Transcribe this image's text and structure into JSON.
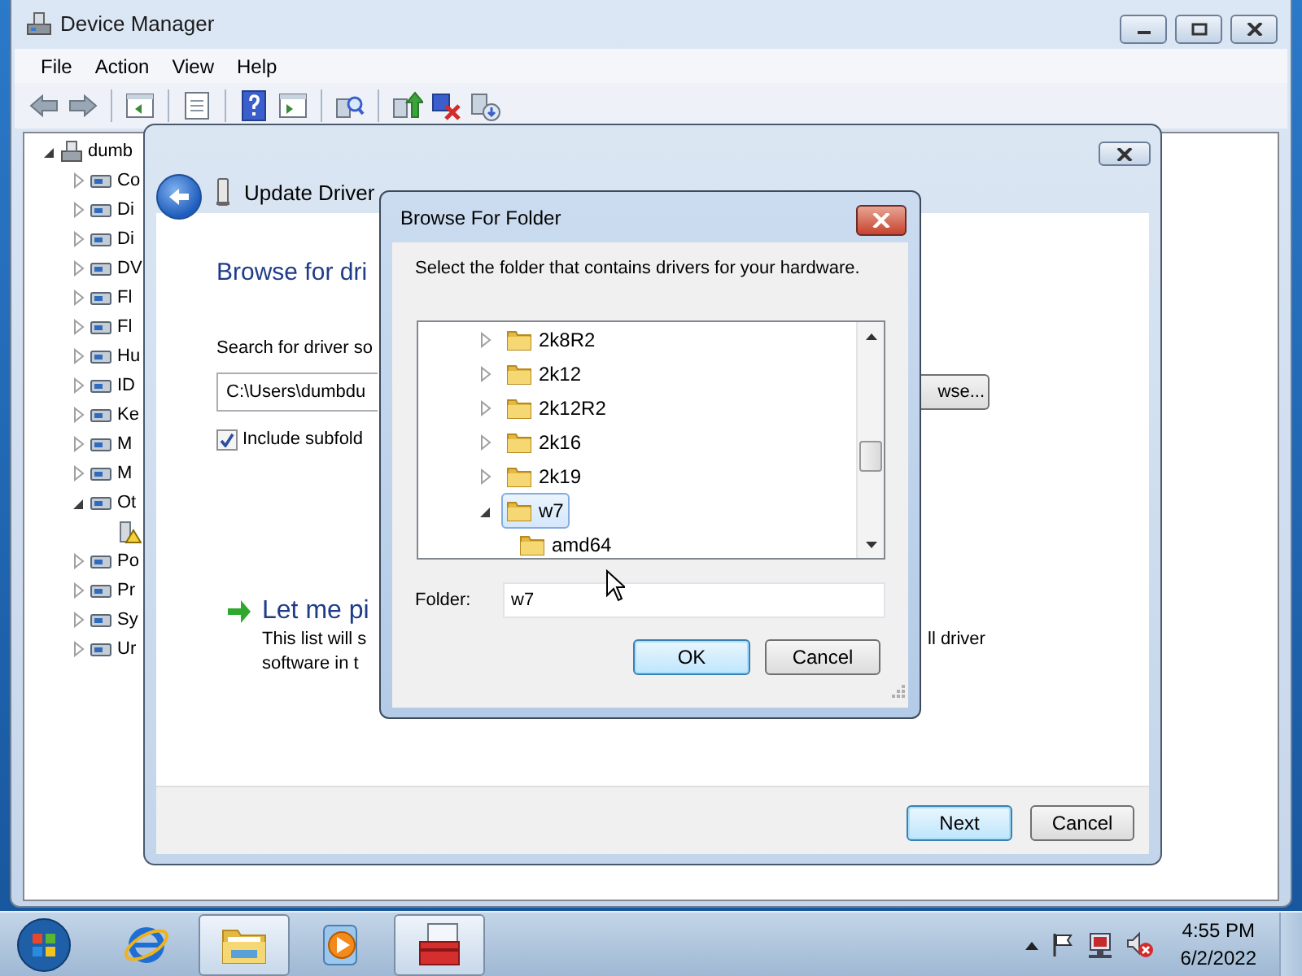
{
  "device_manager": {
    "title": "Device Manager",
    "menu": [
      "File",
      "Action",
      "View",
      "Help"
    ],
    "tree": [
      {
        "label": "dumb",
        "kind": "computer",
        "expanded": true,
        "children": [
          {
            "label": "Co",
            "kind": "device",
            "expanded": false
          },
          {
            "label": "Di",
            "kind": "device",
            "expanded": false
          },
          {
            "label": "Di",
            "kind": "device",
            "expanded": false
          },
          {
            "label": "DV",
            "kind": "device",
            "expanded": false
          },
          {
            "label": "Fl",
            "kind": "device",
            "expanded": false
          },
          {
            "label": "Fl",
            "kind": "device",
            "expanded": false
          },
          {
            "label": "Hu",
            "kind": "device",
            "expanded": false
          },
          {
            "label": "ID",
            "kind": "device",
            "expanded": false
          },
          {
            "label": "Ke",
            "kind": "device",
            "expanded": false
          },
          {
            "label": "M",
            "kind": "device",
            "expanded": false
          },
          {
            "label": "M",
            "kind": "device",
            "expanded": false
          },
          {
            "label": "Ot",
            "kind": "device",
            "expanded": true,
            "children": [
              {
                "kind": "warning"
              }
            ]
          },
          {
            "label": "Po",
            "kind": "device",
            "expanded": false
          },
          {
            "label": "Pr",
            "kind": "device",
            "expanded": false
          },
          {
            "label": "Sy",
            "kind": "device",
            "expanded": false
          },
          {
            "label": "Ur",
            "kind": "device",
            "expanded": false
          }
        ]
      }
    ]
  },
  "wizard": {
    "title": "Update Driver",
    "heading": "Browse for dri",
    "search_label": "Search for driver so",
    "path": "C:\\Users\\dumbdu",
    "browse_button": "wse...",
    "include_subfolders": {
      "label": "Include subfold",
      "checked": true
    },
    "pick_title": "Let me pi",
    "pick_line_1": "This list will s",
    "pick_line_1_end": "ll driver",
    "pick_line_2": "software in t",
    "buttons": [
      {
        "label": "Next",
        "default": true
      },
      {
        "label": "Cancel",
        "default": false
      }
    ]
  },
  "browse_dialog": {
    "title": "Browse For Folder",
    "prompt": "Select the folder that contains drivers for your hardware.",
    "folders": [
      {
        "label": "2k8R2",
        "expanded": false,
        "selected": false
      },
      {
        "label": "2k12",
        "expanded": false,
        "selected": false
      },
      {
        "label": "2k12R2",
        "expanded": false,
        "selected": false
      },
      {
        "label": "2k16",
        "expanded": false,
        "selected": false
      },
      {
        "label": "2k19",
        "expanded": false,
        "selected": false
      },
      {
        "label": "w7",
        "expanded": true,
        "selected": true,
        "children": [
          {
            "label": "amd64",
            "selected": false
          }
        ]
      }
    ],
    "folder_label": "Folder:",
    "folder_value": "w7",
    "buttons": [
      {
        "label": "OK",
        "default": true
      },
      {
        "label": "Cancel",
        "default": false
      }
    ]
  },
  "taskbar": {
    "apps": [
      {
        "kind": "browser",
        "active": false
      },
      {
        "kind": "explorer",
        "active": true
      },
      {
        "kind": "media",
        "active": false
      },
      {
        "kind": "toolbox",
        "active": true
      }
    ],
    "clock": {
      "time": "4:55 PM",
      "date": "6/2/2022"
    }
  }
}
